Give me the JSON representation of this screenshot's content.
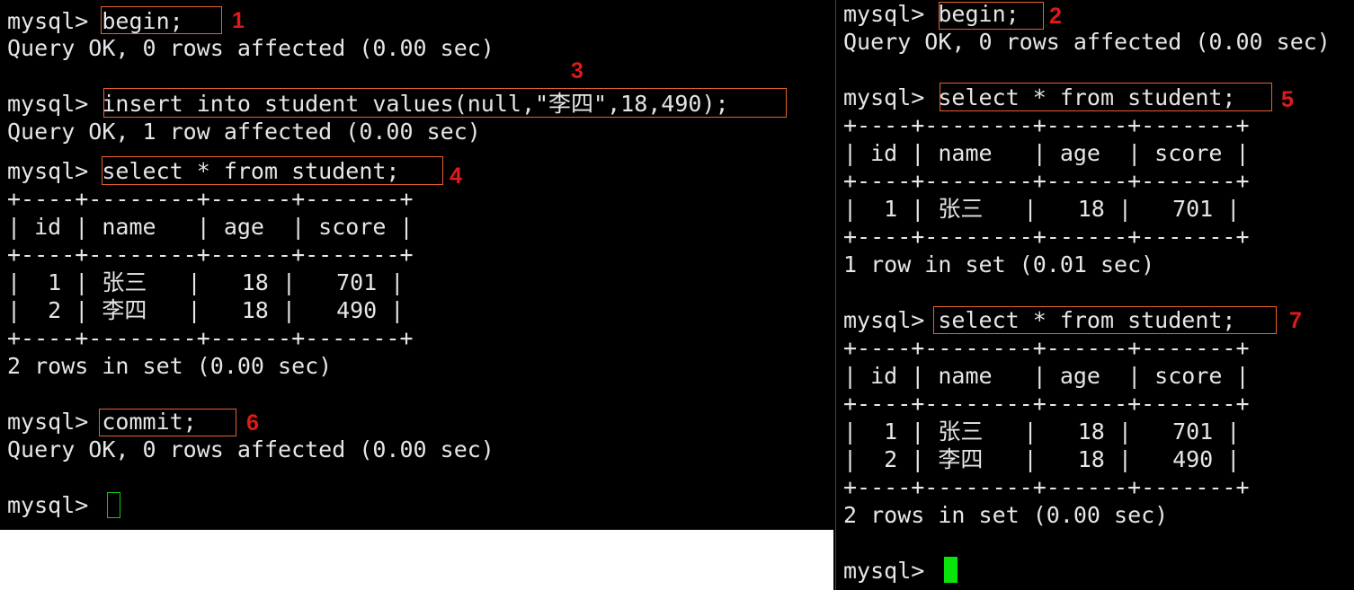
{
  "left_terminal": {
    "lines": [
      "mysql> begin;",
      "Query OK, 0 rows affected (0.00 sec)",
      "",
      "mysql> insert into student values(null,\"李四\",18,490);",
      "Query OK, 1 row affected (0.00 sec)",
      "mysql> select * from student;",
      "+----+--------+------+-------+",
      "| id | name   | age  | score |",
      "+----+--------+------+-------+",
      "|  1 | 张三   |   18 |   701 |",
      "|  2 | 李四   |   18 |   490 |",
      "+----+--------+------+-------+",
      "2 rows in set (0.00 sec)",
      "",
      "mysql> commit;",
      "Query OK, 0 rows affected (0.00 sec)",
      "",
      "mysql> "
    ]
  },
  "right_terminal": {
    "lines": [
      "mysql> begin;",
      "Query OK, 0 rows affected (0.00 sec)",
      "",
      "mysql> select * from student;",
      "+----+--------+------+-------+",
      "| id | name   | age  | score |",
      "+----+--------+------+-------+",
      "|  1 | 张三   |   18 |   701 |",
      "+----+--------+------+-------+",
      "1 row in set (0.01 sec)",
      "",
      "mysql> select * from student;",
      "+----+--------+------+-------+",
      "| id | name   | age  | score |",
      "+----+--------+------+-------+",
      "|  1 | 张三   |   18 |   701 |",
      "|  2 | 李四   |   18 |   490 |",
      "+----+--------+------+-------+",
      "2 rows in set (0.00 sec)",
      "",
      "mysql> "
    ]
  },
  "step_labels": [
    "1",
    "2",
    "3",
    "4",
    "5",
    "6",
    "7"
  ],
  "colors": {
    "terminal_bg": "#000000",
    "terminal_text": "#e6e6e6",
    "annotation_box": "#e8622c",
    "annotation_number": "#e01a1a",
    "cursor_inactive": "#19c919",
    "cursor_active": "#0be40b"
  }
}
